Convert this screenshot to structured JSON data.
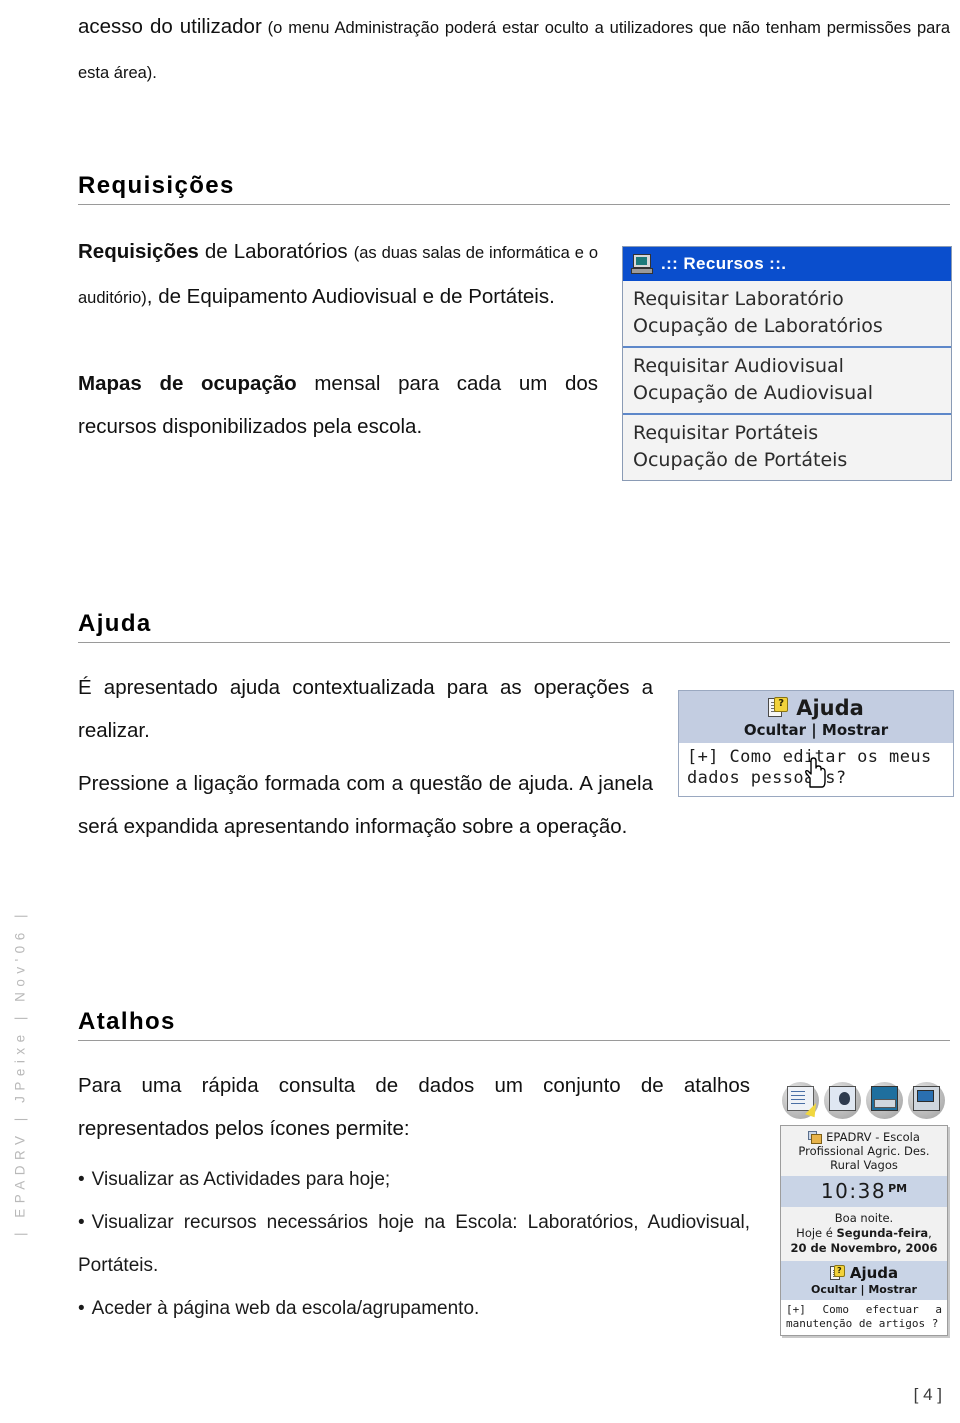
{
  "running_head": "| EPADRV | JPeixe | Nov'06 |",
  "page_number": "[ 4 ]",
  "intro": {
    "line": "acesso do utilizador (o menu Administração poderá estar oculto a utilizadores que não tenham permissões para esta área).",
    "lead": "acesso do utilizador",
    "rest": " (o menu Administração poderá estar oculto a utilizadores que não tenham permissões para esta área)."
  },
  "sections": [
    {
      "id": "requisicoes",
      "heading": "Requisições",
      "p1_bold": "Requisições",
      "p1_mid": " de Laboratórios ",
      "p1_small": "(as duas salas de informática e o auditório)",
      "p1_tail": ", de Equipamento Audiovisual e de Portáteis.",
      "p2_bold": "Mapas de ocupação",
      "p2_rest": " mensal para cada um dos recursos disponibilizados pela escola."
    },
    {
      "id": "ajuda",
      "heading": "Ajuda",
      "p1": "É apresentado ajuda contextualizada para as operações a realizar.",
      "p2": "Pressione a ligação formada com a questão de ajuda. A janela será expandida apresentando informação sobre a operação."
    },
    {
      "id": "atalhos",
      "heading": "Atalhos",
      "p1": "Para uma rápida consulta de dados um conjunto de atalhos representados pelos ícones permite:",
      "bullets": [
        "Visualizar as Actividades para hoje;",
        "Visualizar recursos necessários hoje na Escola: Laboratórios, Audiovisual, Portáteis.",
        "Aceder à página web da escola/agrupamento."
      ],
      "bullet_char": "•"
    }
  ],
  "screenshot_recursos": {
    "icon": "computer-monitor-icon",
    "title": ".:: Recursos ::.",
    "header_color": "#0a4ecd",
    "groups": [
      {
        "items": [
          "Requisitar Laboratório",
          "Ocupação de Laboratórios"
        ]
      },
      {
        "items": [
          "Requisitar Audiovisual",
          "Ocupação de Audiovisual"
        ]
      },
      {
        "items": [
          "Requisitar Portáteis",
          "Ocupação de Portáteis"
        ]
      }
    ]
  },
  "screenshot_ajuda": {
    "icon": "help-document-icon",
    "title": "Ajuda",
    "hide_label": "Ocultar",
    "separator": "|",
    "show_label": "Mostrar",
    "question": "[+] Como editar os meus dados pessoais?",
    "header_color": "#c3cde1",
    "cursor": "hand-cursor"
  },
  "screenshot_atalhos": {
    "icons": [
      "activities-document-icon",
      "laboratory-board-icon",
      "audiovisual-projector-icon",
      "laptop-icon"
    ],
    "panel": {
      "school_icon": "school-house-icon",
      "school_line1": "EPADRV - Escola",
      "school_line2": "Profissional Agric. Des.",
      "school_line3": "Rural Vagos",
      "clock_hour": "10",
      "clock_sep": ":",
      "clock_minute": "38",
      "clock_ampm": "PM",
      "greeting": "Boa noite.",
      "today_prefix": "Hoje é ",
      "today_weekday": "Segunda-feira",
      "today_comma": ",",
      "today_date": "20 de Novembro, 2006",
      "help_icon": "help-document-icon",
      "help_title": "Ajuda",
      "hide_label": "Ocultar",
      "separator": "|",
      "show_label": "Mostrar",
      "question": "[+] Como efectuar a manutenção de artigos ?",
      "accent_color": "#c9d4e6"
    }
  }
}
